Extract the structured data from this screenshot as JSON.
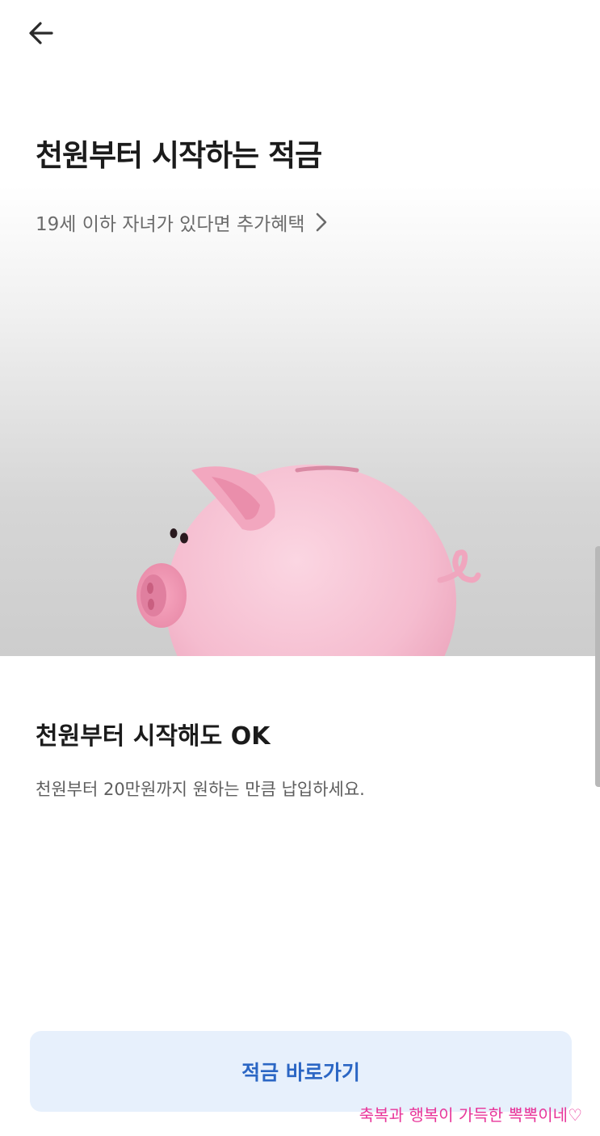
{
  "header": {
    "back_icon": "arrow-left-icon"
  },
  "hero": {
    "title": "천원부터 시작하는 적금",
    "benefit_link": "19세 이하 자녀가 있다면 추가혜택",
    "benefit_chevron_icon": "chevron-right-icon",
    "illustration": "piggy-bank-icon"
  },
  "feature": {
    "title": "천원부터 시작해도 OK",
    "description": "천원부터 20만원까지 원하는 만큼 납입하세요."
  },
  "cta": {
    "label": "적금 바로가기"
  },
  "watermark": {
    "text": "축복과 행복이 가득한 뽁뽁이네",
    "heart": "♡"
  },
  "colors": {
    "accent": "#2b66c4",
    "cta_bg": "#e7f0fc",
    "pig": "#f4b9cd",
    "watermark": "#e8359a"
  }
}
